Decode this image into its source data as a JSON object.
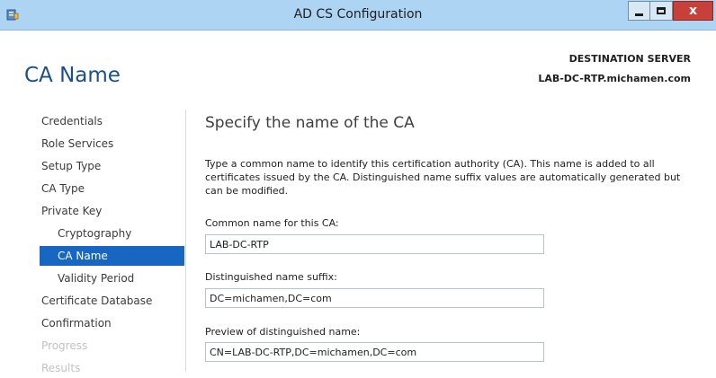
{
  "window": {
    "title": "AD CS Configuration",
    "close_glyph": "x"
  },
  "header": {
    "page_title": "CA Name",
    "destination_label": "DESTINATION SERVER",
    "destination_server": "LAB-DC-RTP.michamen.com"
  },
  "nav": {
    "items": [
      {
        "label": "Credentials",
        "state": "normal"
      },
      {
        "label": "Role Services",
        "state": "normal"
      },
      {
        "label": "Setup Type",
        "state": "normal"
      },
      {
        "label": "CA Type",
        "state": "normal"
      },
      {
        "label": "Private Key",
        "state": "normal"
      },
      {
        "label": "Cryptography",
        "state": "sub"
      },
      {
        "label": "CA Name",
        "state": "active"
      },
      {
        "label": "Validity Period",
        "state": "sub"
      },
      {
        "label": "Certificate Database",
        "state": "normal"
      },
      {
        "label": "Confirmation",
        "state": "normal"
      },
      {
        "label": "Progress",
        "state": "disabled"
      },
      {
        "label": "Results",
        "state": "disabled"
      }
    ]
  },
  "main": {
    "heading": "Specify the name of the CA",
    "description": "Type a common name to identify this certification authority (CA). This name is added to all certificates issued by the CA. Distinguished name suffix values are automatically generated but can be modified.",
    "common_name_label": "Common name for this CA:",
    "common_name_value": "LAB-DC-RTP",
    "dn_suffix_label": "Distinguished name suffix:",
    "dn_suffix_value": "DC=michamen,DC=com",
    "preview_label": "Preview of distinguished name:",
    "preview_value": "CN=LAB-DC-RTP,DC=michamen,DC=com"
  },
  "colors": {
    "titlebar": "#aed4f3",
    "accent": "#1766c2",
    "title_text": "#1a4f8c",
    "close_button": "#c7413a"
  },
  "icons": {
    "app": "server-manager-icon",
    "minimize": "minimize-icon",
    "maximize": "maximize-icon",
    "close": "close-icon"
  }
}
